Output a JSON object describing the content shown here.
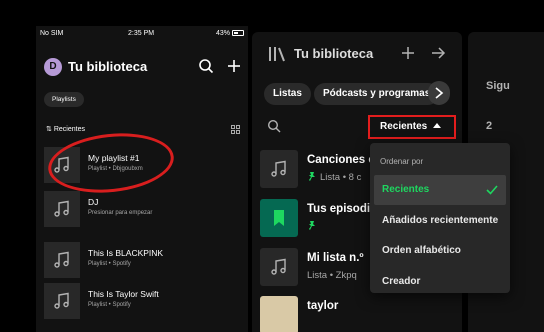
{
  "phone": {
    "status_bar": {
      "carrier": "No SIM",
      "time": "2:35 PM",
      "battery": "43%"
    },
    "avatar_letter": "D",
    "title": "Tu biblioteca",
    "filter_chip": "Playlists",
    "sort_label": "Recientes",
    "items": [
      {
        "name": "My playlist #1",
        "subtitle": "Playlist • Dbjgoubxm"
      },
      {
        "name": "DJ",
        "subtitle": "Presionar para empezar"
      },
      {
        "name": "This Is BLACKPINK",
        "subtitle": "Playlist • Spotify"
      },
      {
        "name": "This Is Taylor Swift",
        "subtitle": "Playlist • Spotify"
      }
    ]
  },
  "desktop": {
    "title": "Tu biblioteca",
    "chips": [
      "Listas",
      "Pódcasts y programas"
    ],
    "sort_button_label": "Recientes",
    "items": [
      {
        "name": "Canciones c",
        "subtitle": "Lista • 8 c",
        "pinned": true
      },
      {
        "name": "Tus episodi",
        "subtitle": "",
        "pinned": true
      },
      {
        "name": "Mi lista n.º",
        "subtitle": "Lista • Zkpq",
        "pinned": false
      },
      {
        "name": "taylor",
        "subtitle": "",
        "pinned": false
      }
    ],
    "dropdown": {
      "header": "Ordenar por",
      "options": [
        "Recientes",
        "Añadidos recientemente",
        "Orden alfabético",
        "Creador"
      ],
      "selected": "Recientes"
    },
    "side_panel": {
      "line1": "Sigu",
      "line2": "2"
    }
  },
  "colors": {
    "accent_green": "#1ed760",
    "highlight_red": "#e31d1d",
    "background": "#121212"
  }
}
